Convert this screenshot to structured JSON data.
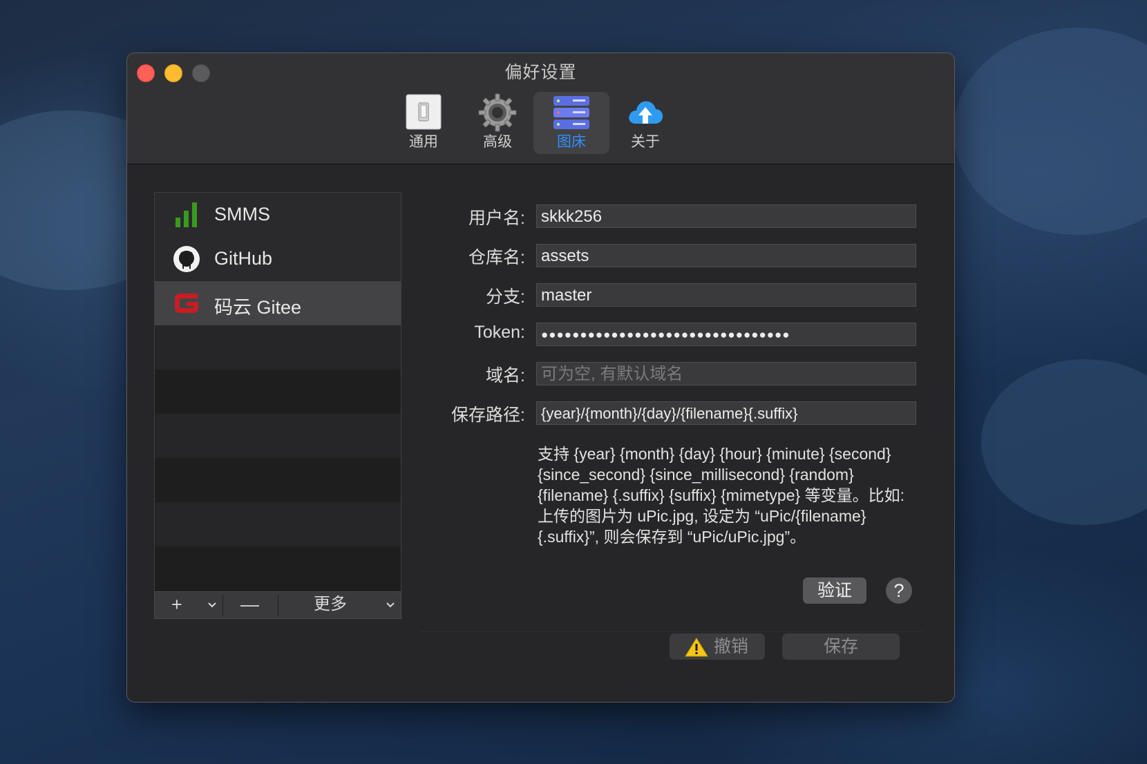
{
  "window": {
    "title": "偏好设置"
  },
  "toolbar": {
    "tabs": [
      {
        "label": "通用",
        "icon": "light-switch-icon"
      },
      {
        "label": "高级",
        "icon": "gear-icon"
      },
      {
        "label": "图床",
        "icon": "server-stack-icon",
        "selected": true
      },
      {
        "label": "关于",
        "icon": "cloud-upload-icon"
      }
    ]
  },
  "hosts": {
    "items": [
      {
        "label": "SMMS",
        "icon": "signal-bars-icon"
      },
      {
        "label": "GitHub",
        "icon": "github-icon"
      },
      {
        "label": "码云 Gitee",
        "icon": "gitee-icon",
        "selected": true
      }
    ],
    "add_label": "+",
    "remove_label": "—",
    "more_label": "更多"
  },
  "form": {
    "username": {
      "label": "用户名:",
      "value": "skkk256"
    },
    "repo": {
      "label": "仓库名:",
      "value": "assets"
    },
    "branch": {
      "label": "分支:",
      "value": "master"
    },
    "token": {
      "label": "Token:",
      "value": "●●●●●●●●●●●●●●●●●●●●●●●●●●●●●●●●"
    },
    "domain": {
      "label": "域名:",
      "placeholder": "可为空, 有默认域名"
    },
    "save_path": {
      "label": "保存路径:",
      "value": "{year}/{month}/{day}/{filename}{.suffix}"
    },
    "help_text": "支持 {year} {month} {day} {hour} {minute} {second} {since_second} {since_millisecond} {random} {filename} {.suffix} {suffix} {mimetype} 等变量。比如: 上传的图片为 uPic.jpg, 设定为 “uPic/{filename}{.suffix}”, 则会保存到 “uPic/uPic.jpg”。",
    "verify_label": "验证",
    "help_label": "?",
    "cancel_label": "撤销",
    "save_label": "保存"
  },
  "colors": {
    "accent": "#2e8fff",
    "close": "#fe5f57",
    "minimize": "#febc2e",
    "gitee_red": "#c71d23",
    "smms_green": "#3a9a1e"
  }
}
